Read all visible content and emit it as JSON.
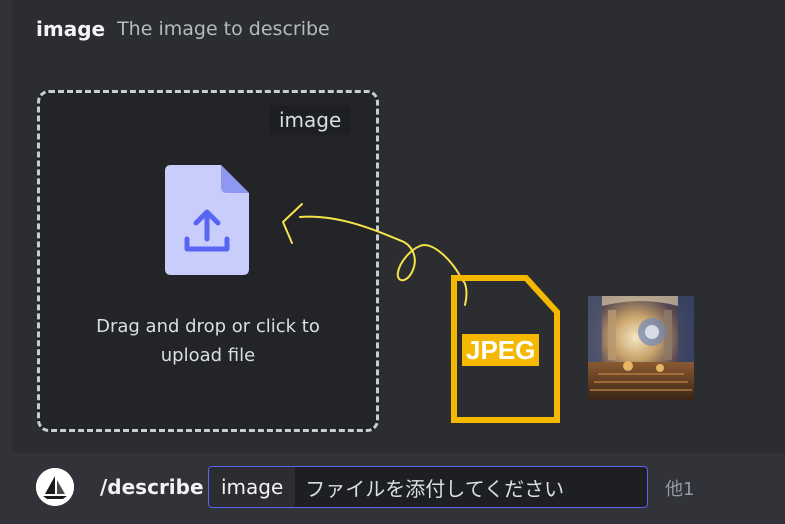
{
  "header": {
    "option_name": "image",
    "option_description": "The image to describe"
  },
  "upload": {
    "tag": "image",
    "instruction_line1": "Drag and drop or click to",
    "instruction_line2": "upload file"
  },
  "annotation": {
    "file_type_label": "JPEG"
  },
  "command_bar": {
    "command": "/describe",
    "option_key": "image",
    "option_value": "ファイルを添付してください",
    "more_options": "他1"
  },
  "colors": {
    "accent": "#5865f2",
    "upload_icon": "#c9cdfb",
    "annotation": "#f5b800"
  }
}
